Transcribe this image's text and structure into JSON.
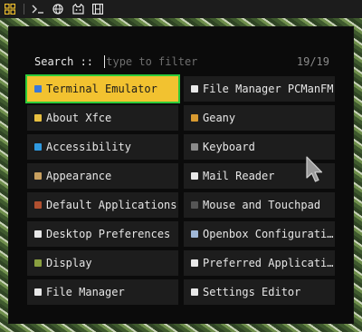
{
  "panel": {
    "icons": [
      {
        "name": "app-grid-icon",
        "glyph": "⊞"
      },
      {
        "name": "terminal-icon",
        "glyph": ">_"
      },
      {
        "name": "globe-icon",
        "glyph": "⊕"
      },
      {
        "name": "cat-icon",
        "glyph": "ᗢ"
      },
      {
        "name": "film-icon",
        "glyph": "▤"
      }
    ]
  },
  "launcher": {
    "search_label": "Search :: ",
    "search_placeholder": "type to filter",
    "search_value": "",
    "result_count": "19/19",
    "items": [
      {
        "label": "Terminal Emulator",
        "icon": "terminal-icon",
        "icon_color": "#3a78d8",
        "selected": true
      },
      {
        "label": "File Manager PCManFM",
        "icon": "folder-icon",
        "icon_color": "#e8e8e8",
        "selected": false
      },
      {
        "label": "About Xfce",
        "icon": "info-star-icon",
        "icon_color": "#e8c040",
        "selected": false
      },
      {
        "label": "Geany",
        "icon": "geany-icon",
        "icon_color": "#d89a30",
        "selected": false
      },
      {
        "label": "Accessibility",
        "icon": "accessibility-icon",
        "icon_color": "#2f9ae0",
        "selected": false
      },
      {
        "label": "Keyboard",
        "icon": "keyboard-icon",
        "icon_color": "#8a8a8a",
        "selected": false
      },
      {
        "label": "Appearance",
        "icon": "appearance-icon",
        "icon_color": "#c8a060",
        "selected": false
      },
      {
        "label": "Mail Reader",
        "icon": "mail-icon",
        "icon_color": "#e8e8e8",
        "selected": false
      },
      {
        "label": "Default Applications",
        "icon": "default-apps-icon",
        "icon_color": "#b05030",
        "selected": false
      },
      {
        "label": "Mouse and Touchpad",
        "icon": "mouse-icon",
        "icon_color": "#555555",
        "selected": false
      },
      {
        "label": "Desktop Preferences",
        "icon": "desktop-prefs-icon",
        "icon_color": "#e8e8e8",
        "selected": false
      },
      {
        "label": "Openbox Configuration…",
        "icon": "openbox-icon",
        "icon_color": "#a0b8d8",
        "selected": false
      },
      {
        "label": "Display",
        "icon": "display-icon",
        "icon_color": "#8aa040",
        "selected": false
      },
      {
        "label": "Preferred Applications",
        "icon": "preferred-apps-icon",
        "icon_color": "#e8e8e8",
        "selected": false
      },
      {
        "label": "File Manager",
        "icon": "file-manager-icon",
        "icon_color": "#e8e8e8",
        "selected": false
      },
      {
        "label": "Settings Editor",
        "icon": "settings-editor-icon",
        "icon_color": "#e8e8e8",
        "selected": false
      }
    ]
  },
  "colors": {
    "selection_bg": "#f2c230",
    "selection_outline": "#2ecb3a",
    "item_bg": "#1d1d1d",
    "launcher_bg": "#0b0b0b"
  }
}
